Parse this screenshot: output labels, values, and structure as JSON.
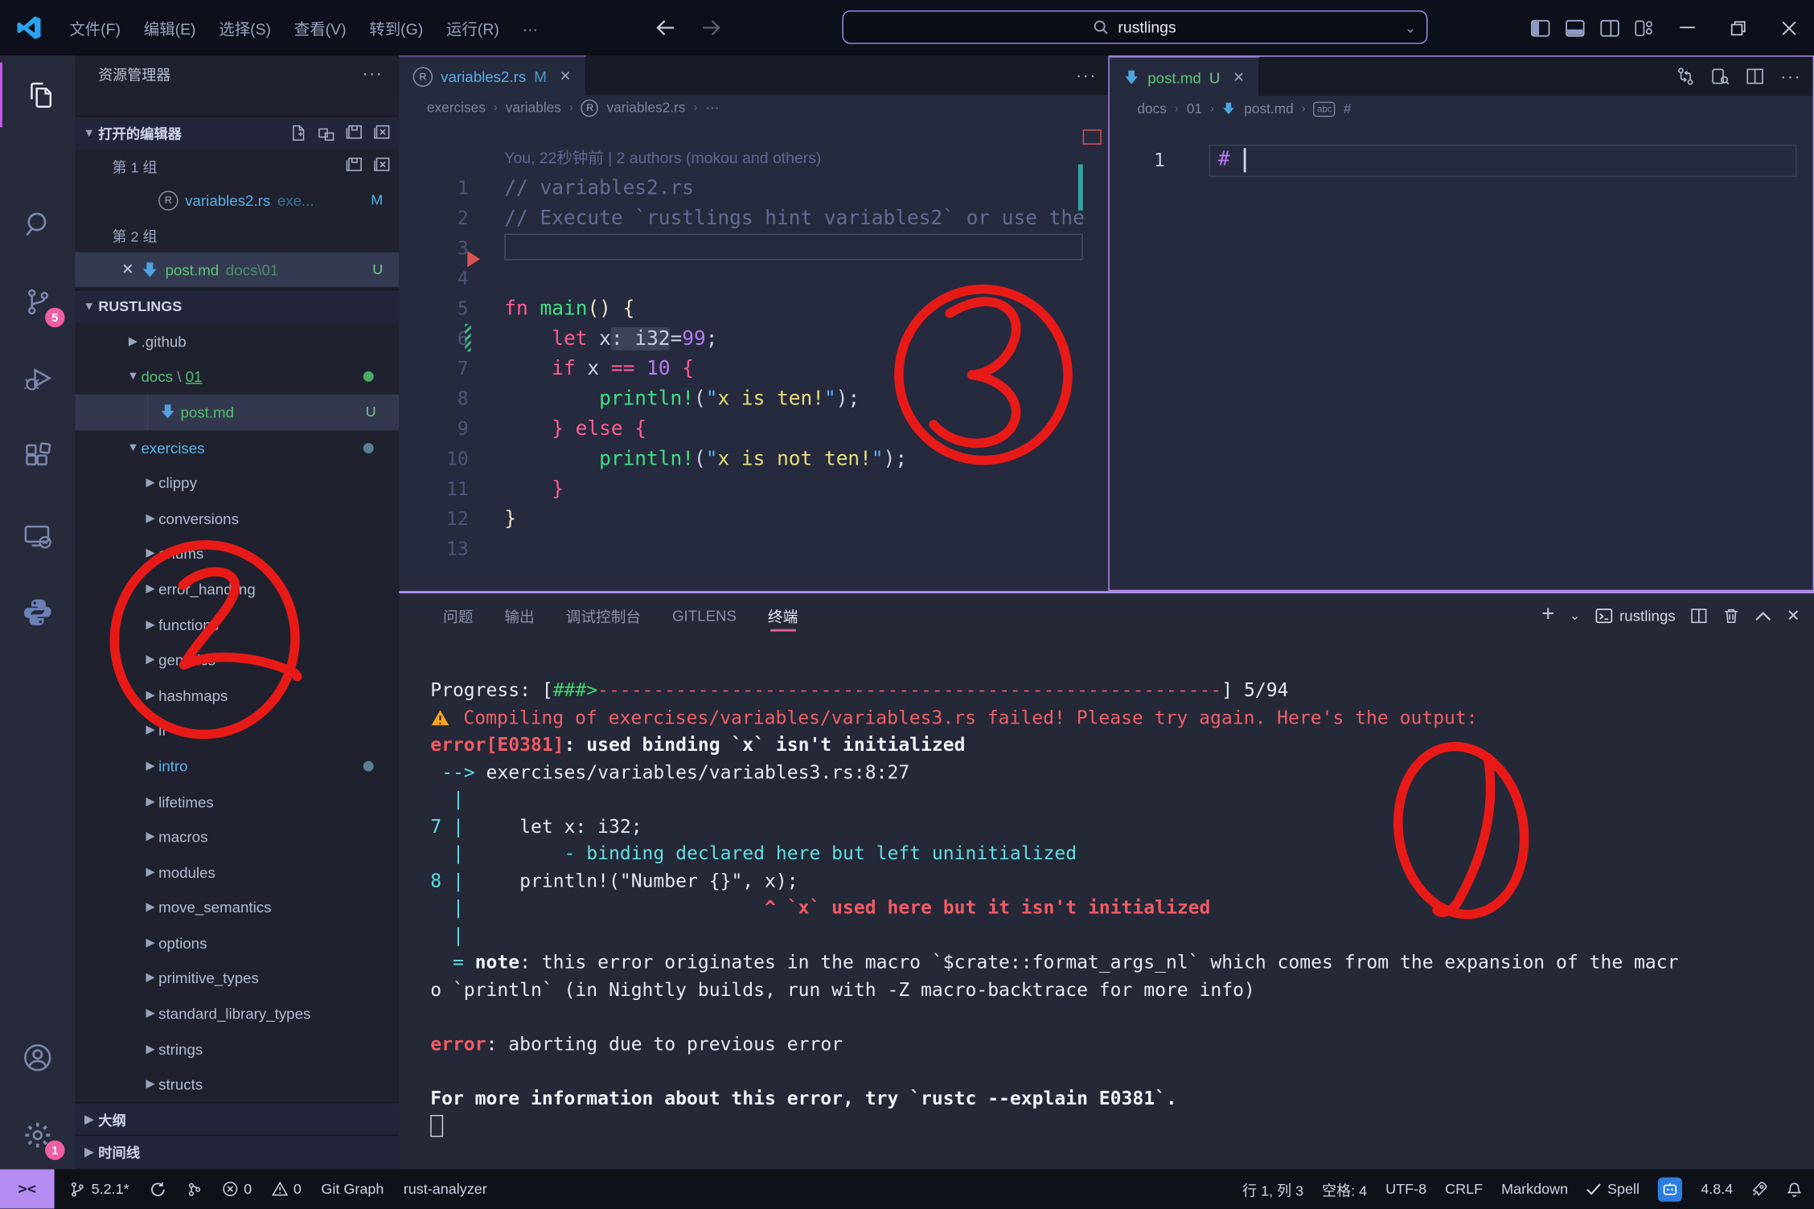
{
  "colors": {
    "accent_purple": "#b292f2",
    "annotation_red": "#e81a17",
    "error_red": "#ef5f67",
    "hint_cyan": "#62dde2",
    "progress_green": "#3fd66b",
    "untracked_green": "#73c991",
    "modified_blue": "#57aee6",
    "panel_tab_underline": "#e0609f"
  },
  "titlebar": {
    "menus": [
      "文件(F)",
      "编辑(E)",
      "选择(S)",
      "查看(V)",
      "转到(G)",
      "运行(R)",
      "···"
    ],
    "search_value": "rustlings"
  },
  "activity_bar": {
    "scm_badge": "5",
    "settings_badge": "1"
  },
  "sidebar": {
    "title": "资源管理器",
    "open_editors_header": "打开的编辑器",
    "group1_label": "第 1 组",
    "group1_file": "variables2.rs",
    "group1_path": "exe...",
    "group1_badge": "M",
    "group2_label": "第 2 组",
    "group2_file": "post.md",
    "group2_path": "docs\\01",
    "group2_badge": "U",
    "project": "RUSTLINGS",
    "tree": [
      {
        "label": ".github",
        "lv": 1,
        "chev": "r",
        "cls": ""
      },
      {
        "segs": [
          [
            "c-grn",
            "docs"
          ],
          [
            "c-dim",
            " \\ "
          ],
          [
            "c-grnu",
            "01"
          ]
        ],
        "lv": 1,
        "chev": "d",
        "right": "dot-grn",
        "name": "docs-01"
      },
      {
        "label": "post.md",
        "lv": 2,
        "chev": "n",
        "icon": "md",
        "cls": "c-grn",
        "right": "U",
        "sel": true,
        "guide": true
      },
      {
        "label": "exercises",
        "lv": 1,
        "chev": "d",
        "cls": "c-cyn",
        "right": "dot-sl"
      },
      {
        "label": "clippy",
        "lv": 2,
        "chev": "r",
        "cls": ""
      },
      {
        "label": "conversions",
        "lv": 2,
        "chev": "r",
        "cls": ""
      },
      {
        "label": "enums",
        "lv": 2,
        "chev": "r",
        "cls": ""
      },
      {
        "label": "error_handling",
        "lv": 2,
        "chev": "r",
        "cls": ""
      },
      {
        "label": "functions",
        "lv": 2,
        "chev": "r",
        "cls": ""
      },
      {
        "label": "generics",
        "lv": 2,
        "chev": "r",
        "cls": ""
      },
      {
        "label": "hashmaps",
        "lv": 2,
        "chev": "r",
        "cls": ""
      },
      {
        "label": "if",
        "lv": 2,
        "chev": "r",
        "cls": ""
      },
      {
        "label": "intro",
        "lv": 2,
        "chev": "r",
        "cls": "c-cyn",
        "right": "dot-sl"
      },
      {
        "label": "lifetimes",
        "lv": 2,
        "chev": "r",
        "cls": ""
      },
      {
        "label": "macros",
        "lv": 2,
        "chev": "r",
        "cls": ""
      },
      {
        "label": "modules",
        "lv": 2,
        "chev": "r",
        "cls": ""
      },
      {
        "label": "move_semantics",
        "lv": 2,
        "chev": "r",
        "cls": ""
      },
      {
        "label": "options",
        "lv": 2,
        "chev": "r",
        "cls": ""
      },
      {
        "label": "primitive_types",
        "lv": 2,
        "chev": "r",
        "cls": ""
      },
      {
        "label": "standard_library_types",
        "lv": 2,
        "chev": "r",
        "cls": ""
      },
      {
        "label": "strings",
        "lv": 2,
        "chev": "r",
        "cls": ""
      },
      {
        "label": "structs",
        "lv": 2,
        "chev": "r",
        "cls": ""
      }
    ],
    "outline": "大纲",
    "timeline": "时间线"
  },
  "editor1": {
    "tab": "variables2.rs",
    "tab_badge": "M",
    "breadcrumbs": [
      "exercises",
      "variables",
      "variables2.rs",
      "···"
    ],
    "blame": "You, 22秒钟前 | 2 authors (mokou and others)",
    "lines": [
      {
        "n": "1",
        "segs": [
          [
            "cmt",
            "// variables2.rs"
          ]
        ]
      },
      {
        "n": "2",
        "segs": [
          [
            "cmt",
            "// Execute `rustlings hint variables2` or use the"
          ]
        ]
      },
      {
        "n": "3",
        "segs": [],
        "box": true
      },
      {
        "n": "4",
        "segs": []
      },
      {
        "n": "5",
        "segs": [
          [
            "kw",
            "fn"
          ],
          [
            "pun",
            " "
          ],
          [
            "fn",
            "main"
          ],
          [
            "brc",
            "() {"
          ]
        ]
      },
      {
        "n": "6",
        "segs": [
          [
            "pun",
            "    "
          ],
          [
            "kw",
            "let"
          ],
          [
            "pun",
            " x"
          ],
          [
            "hl",
            ": i32"
          ],
          [
            "pun",
            "="
          ],
          [
            "num",
            "99"
          ],
          [
            "pun",
            ";"
          ]
        ],
        "mod": true
      },
      {
        "n": "7",
        "segs": [
          [
            "pun",
            "    "
          ],
          [
            "kw",
            "if"
          ],
          [
            "pun",
            " x "
          ],
          [
            "kw",
            "=="
          ],
          [
            "pun",
            " "
          ],
          [
            "num",
            "10"
          ],
          [
            "pun",
            " "
          ],
          [
            "kw",
            "{"
          ]
        ]
      },
      {
        "n": "8",
        "segs": [
          [
            "pun",
            "        "
          ],
          [
            "fn",
            "println!"
          ],
          [
            "pun",
            "("
          ],
          [
            "sq",
            "\""
          ],
          [
            "str",
            "x is ten!"
          ],
          [
            "sq",
            "\""
          ],
          [
            "pun",
            ");"
          ]
        ]
      },
      {
        "n": "9",
        "segs": [
          [
            "pun",
            "    "
          ],
          [
            "kw",
            "} else {"
          ]
        ]
      },
      {
        "n": "10",
        "segs": [
          [
            "pun",
            "        "
          ],
          [
            "fn",
            "println!"
          ],
          [
            "pun",
            "("
          ],
          [
            "sq",
            "\""
          ],
          [
            "str",
            "x is not ten!"
          ],
          [
            "sq",
            "\""
          ],
          [
            "pun",
            ");"
          ]
        ]
      },
      {
        "n": "11",
        "segs": [
          [
            "pun",
            "    "
          ],
          [
            "kw",
            "}"
          ]
        ]
      },
      {
        "n": "12",
        "segs": [
          [
            "brc",
            "}"
          ]
        ]
      },
      {
        "n": "13",
        "segs": []
      }
    ]
  },
  "editor2": {
    "tab": "post.md",
    "tab_badge": "U",
    "breadcrumbs": [
      "docs",
      "01",
      "post.md",
      "#"
    ],
    "line1_number": "1",
    "line1_text": "#"
  },
  "panel": {
    "tabs": [
      "问题",
      "输出",
      "调试控制台",
      "GITLENS",
      "终端"
    ],
    "active_tab": "终端",
    "terminal_name": "rustlings",
    "lines": [
      [
        [
          "w",
          "Progress: ["
        ],
        [
          "g",
          "###>"
        ],
        [
          "rd",
          "--------------------------------------------------------"
        ],
        [
          "w",
          "] 5/94"
        ]
      ],
      [
        [
          "warn",
          ""
        ],
        [
          "r",
          " Compiling of exercises/variables/variables3.rs failed! Please try again. Here's the output:"
        ]
      ],
      [
        [
          "rb",
          "error[E0381]"
        ],
        [
          "wb",
          ": used binding `x` isn't initialized"
        ]
      ],
      [
        [
          "cy",
          " --> "
        ],
        [
          "w",
          "exercises/variables/variables3.rs:8:27"
        ]
      ],
      [
        [
          "cy",
          "  |"
        ]
      ],
      [
        [
          "cy",
          "7 |"
        ],
        [
          "w",
          "     let x: i32;"
        ]
      ],
      [
        [
          "cy",
          "  |         - binding declared here but left uninitialized"
        ]
      ],
      [
        [
          "cy",
          "8 |"
        ],
        [
          "w",
          "     println!(\"Number {}\", x);"
        ]
      ],
      [
        [
          "cy",
          "  |"
        ],
        [
          "rb",
          "                           ^ `x` used here but it isn't initialized"
        ]
      ],
      [
        [
          "cy",
          "  |"
        ]
      ],
      [
        [
          "cy",
          "  = "
        ],
        [
          "wb",
          "note"
        ],
        [
          "w",
          ": this error originates in the macro `$crate::format_args_nl` which comes from the expansion of the macr"
        ]
      ],
      [
        [
          "w",
          "o `println` (in Nightly builds, run with -Z macro-backtrace for more info)"
        ]
      ],
      [],
      [
        [
          "rb",
          "error"
        ],
        [
          "w",
          ": aborting due to previous error"
        ]
      ],
      [],
      [
        [
          "wb",
          "For more information about this error, try `rustc --explain E0381`."
        ]
      ],
      [
        [
          "cursor",
          ""
        ]
      ]
    ]
  },
  "statusbar": {
    "left": [
      {
        "icon": "branch",
        "text": "5.2.1*",
        "n": "git-branch-status"
      },
      {
        "icon": "sync",
        "text": "",
        "n": "sync-status"
      },
      {
        "icon": "gitgraph",
        "text": "",
        "n": "git-graph-icon-status"
      },
      {
        "icon": "err",
        "text": "0",
        "n": "errors-count"
      },
      {
        "icon": "warn2",
        "text": "0",
        "n": "warnings-count"
      },
      {
        "text": "Git Graph",
        "n": "git-graph-label"
      },
      {
        "text": "rust-analyzer",
        "n": "rust-analyzer-status"
      }
    ],
    "right": [
      {
        "text": "行 1, 列 3",
        "n": "cursor-position"
      },
      {
        "text": "空格: 4",
        "n": "indentation"
      },
      {
        "text": "UTF-8",
        "n": "encoding"
      },
      {
        "text": "CRLF",
        "n": "eol"
      },
      {
        "text": "Markdown",
        "n": "language-mode"
      },
      {
        "icon": "check",
        "text": "Spell",
        "n": "spell-checker"
      },
      {
        "icon": "ai",
        "text": "",
        "n": "ai-extension-badge"
      },
      {
        "text": "4.8.4",
        "n": "extension-version"
      },
      {
        "icon": "rocket",
        "text": "",
        "n": "rocket-icon"
      },
      {
        "icon": "bell",
        "text": "",
        "n": "notifications-bell"
      }
    ]
  },
  "annotations": {
    "one": "1",
    "two": "2",
    "three": "3"
  }
}
